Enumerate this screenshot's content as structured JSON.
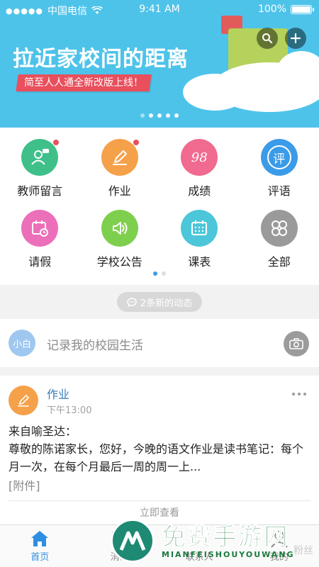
{
  "status_bar": {
    "carrier": "中国电信",
    "time": "9:41 AM",
    "battery": "100%"
  },
  "banner": {
    "title": "拉近家校间的距离",
    "subtitle": "简至人人通全新改版上线！",
    "pages": 5,
    "active_page": 1
  },
  "features": [
    {
      "label": "教师留言",
      "icon": "teacher-message-icon",
      "color": "#3fc08a",
      "badge": true
    },
    {
      "label": "作业",
      "icon": "pencil-icon",
      "color": "#f5a14a",
      "badge": true
    },
    {
      "label": "成绩",
      "icon": "score-icon",
      "color": "#f16a8f",
      "badge": false
    },
    {
      "label": "评语",
      "icon": "comment-icon",
      "color": "#3a9be8",
      "badge": false
    },
    {
      "label": "请假",
      "icon": "calendar-clock-icon",
      "color": "#ec6fb9",
      "badge": false
    },
    {
      "label": "学校公告",
      "icon": "speaker-icon",
      "color": "#7fcf4e",
      "badge": false
    },
    {
      "label": "课表",
      "icon": "schedule-icon",
      "color": "#4cc7d9",
      "badge": false
    },
    {
      "label": "全部",
      "icon": "all-grid-icon",
      "color": "#9a9a9a",
      "badge": false
    }
  ],
  "grid_pager": {
    "pages": 2,
    "active_page": 1
  },
  "score_glyph": "98",
  "comment_glyph": "评",
  "notice": "2条新的动态",
  "composer": {
    "avatar_text": "小白",
    "placeholder": "记录我的校园生活"
  },
  "feed": {
    "title": "作业",
    "time": "下午13:00",
    "sender_line": "来自喻圣达：",
    "content": "尊敬的陈诺家长，您好，今晚的语文作业是读书笔记：每个月一次，在每个月最后一周的周一上...",
    "attachment": "[附件]",
    "view_link": "立即查看"
  },
  "tabs": [
    {
      "label": "首页",
      "icon": "home-icon",
      "active": true
    },
    {
      "label": "消息",
      "icon": "message-icon",
      "active": false
    },
    {
      "label": "联系人",
      "icon": "contacts-icon",
      "active": false
    },
    {
      "label": "我的",
      "icon": "profile-icon",
      "active": false
    }
  ],
  "watermark": {
    "title": "免费手游网",
    "sub": "MIANFEISHOUYOUWANG",
    "partial_text": "粉丝"
  },
  "colors": {
    "banner_bg": "#4ec3ea",
    "accent_blue": "#2e8ee0",
    "ribbon_red": "#e94f5c"
  }
}
